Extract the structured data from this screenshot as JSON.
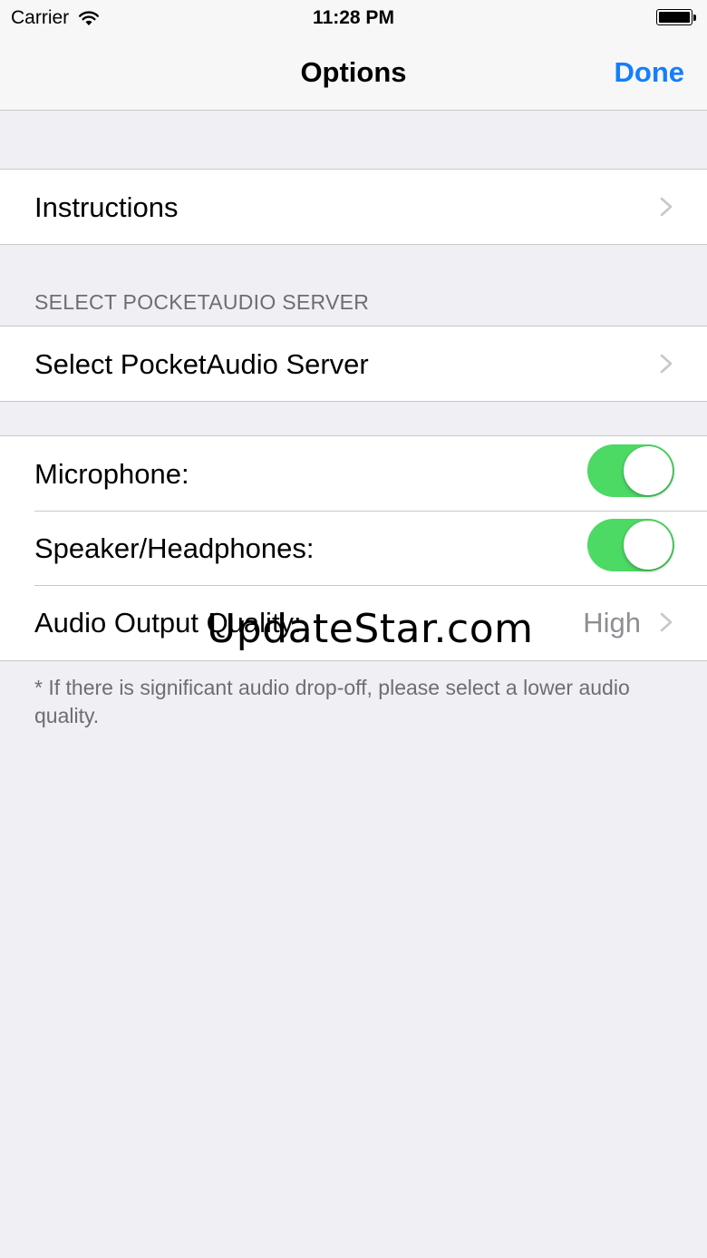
{
  "status_bar": {
    "carrier": "Carrier",
    "time": "11:28 PM"
  },
  "nav": {
    "title": "Options",
    "done_label": "Done"
  },
  "group1": {
    "instructions_label": "Instructions"
  },
  "group2": {
    "header": "SELECT POCKETAUDIO SERVER",
    "server_label": "Select PocketAudio Server"
  },
  "group3": {
    "microphone_label": "Microphone:",
    "microphone_on": true,
    "speaker_label": "Speaker/Headphones:",
    "speaker_on": true,
    "quality_label": "Audio Output Quality:",
    "quality_value": "High"
  },
  "footer_note": "* If there is significant audio drop-off, please select a lower audio quality.",
  "watermark": "UpdateStar.com",
  "colors": {
    "accent": "#157efb",
    "toggle_on": "#4cd964",
    "background": "#efeff4"
  },
  "icons": [
    "wifi-icon",
    "battery-icon",
    "chevron-right-icon"
  ]
}
